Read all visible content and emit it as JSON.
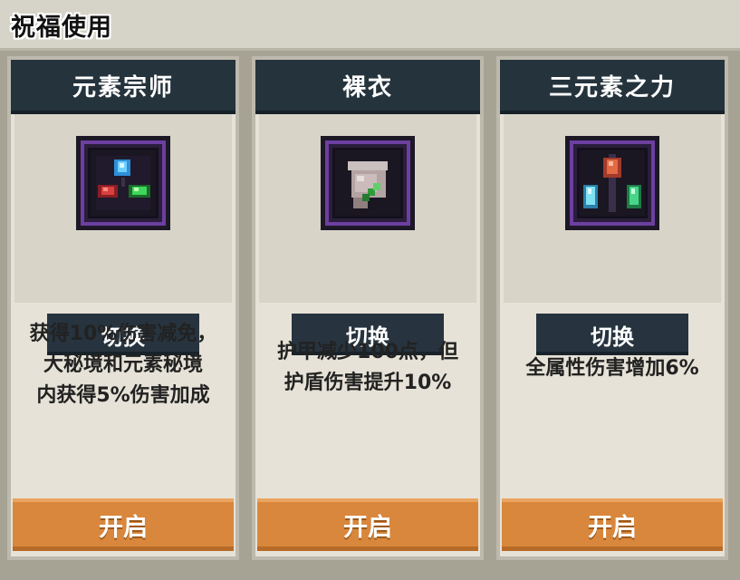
{
  "window": {
    "title": "祝福使用"
  },
  "cards": [
    {
      "name": "元素宗师",
      "icon": "elemental-master-icon",
      "switch_label": "切换",
      "description": "获得10%伤害减免，\n大秘境和元素秘境\n内获得5%伤害加成",
      "open_label": "开启"
    },
    {
      "name": "裸衣",
      "icon": "naked-armor-icon",
      "switch_label": "切换",
      "description": "护甲减少100点，但\n护盾伤害提升10%",
      "open_label": "开启"
    },
    {
      "name": "三元素之力",
      "icon": "three-elements-icon",
      "switch_label": "切换",
      "description": "全属性伤害增加6%",
      "open_label": "开启"
    }
  ],
  "colors": {
    "header_dark": "#25333d",
    "open_button": "#d9873c",
    "card_bg": "#e6e2d7",
    "icon_frame_purple": "#6c3fa0"
  }
}
